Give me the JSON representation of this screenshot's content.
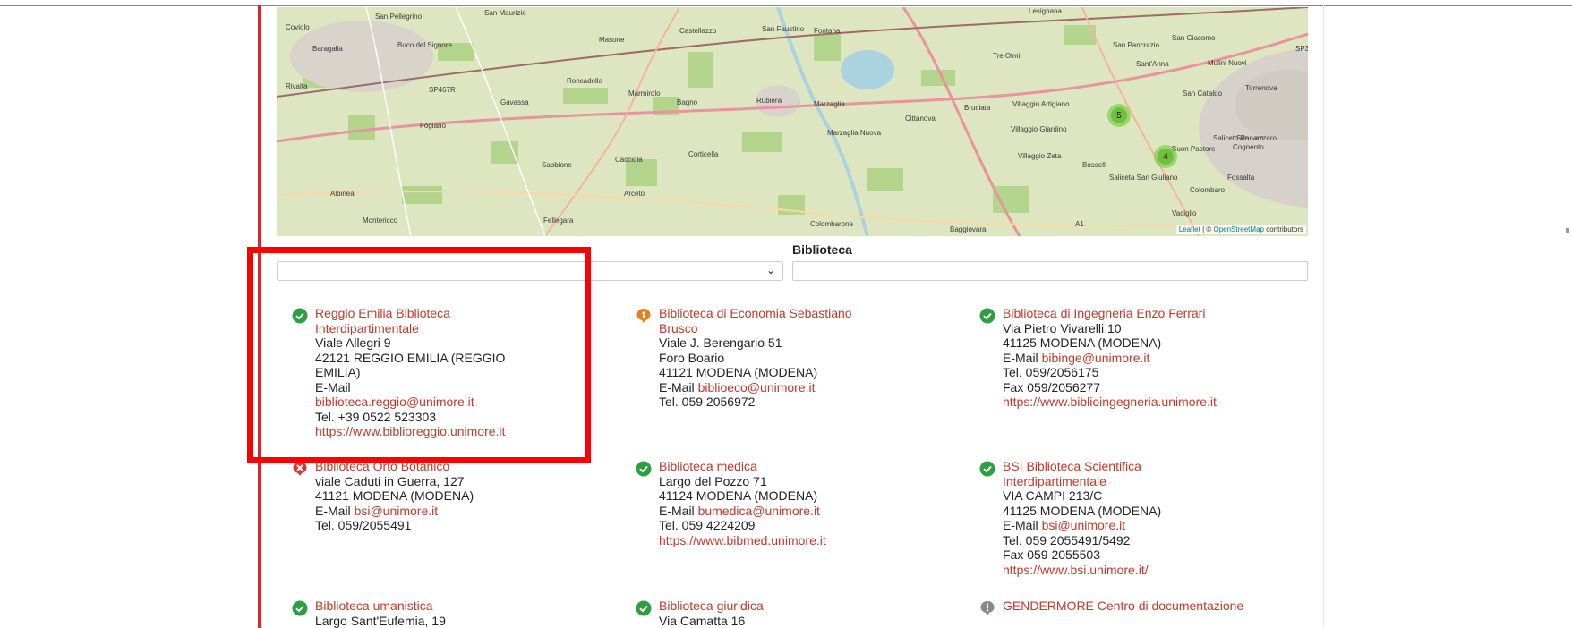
{
  "colors": {
    "accent": "#c0392b",
    "highlight": "#ff0000",
    "open": "#2e9e44",
    "partial": "#e67e22",
    "closed": "#e0322f",
    "unknown": "#888888"
  },
  "map": {
    "labels": [
      "Coviolo",
      "San Pellegrino",
      "San Maurizio",
      "Masone",
      "Castellazzo",
      "San Faustino",
      "Fontana",
      "Lesignana",
      "San Giacomo",
      "San Pancrazio",
      "Tre Olmi",
      "Sant'Anna",
      "Mulini Nuovi",
      "Baragalla",
      "Buco del Signore",
      "Rivalta",
      "SP467R",
      "Roncadella",
      "Marmirolo",
      "Gavassa",
      "Bagno",
      "Rubiera",
      "Marzaglia",
      "Cittanova",
      "Bruciata",
      "Villaggio Artigiano",
      "San Cataldo",
      "Torrenova",
      "Foglano",
      "Marzaglia Nuova",
      "Villaggio Giardino",
      "San Lazzaro",
      "Saliceto Panaro",
      "Cognento",
      "Buon Pastore",
      "Villaggio Zeta",
      "Bosselli",
      "Albinea",
      "Sabbione",
      "Cacciola",
      "Corticella",
      "Saliceta San Giuliano",
      "Colombaro",
      "Fossalta",
      "Montericco",
      "Arceto",
      "Fellegara",
      "Colombarone",
      "Baggiovara",
      "A1",
      "Vaciglio",
      "SP3"
    ],
    "clusters": [
      "5",
      "4"
    ],
    "attribution": {
      "leaflet": "Leaflet",
      "sep": " | © ",
      "osm": "OpenStreetMap",
      "rest": " contributors"
    }
  },
  "filters": {
    "biblioteca_label": "Biblioteca",
    "select_value": "",
    "input_value": ""
  },
  "libraries": [
    {
      "status": "open",
      "name": "Reggio Emilia Biblioteca Interdipartimentale",
      "lines": [
        "Viale Allegri 9",
        "42121 REGGIO EMILIA (REGGIO EMILIA)"
      ],
      "email_label": "E-Mail",
      "email": "biblioteca.reggio@unimore.it",
      "tel": "Tel. +39 0522 523303",
      "fax": "",
      "url": "https://www.biblioreggio.unimore.it"
    },
    {
      "status": "partial",
      "name": "Biblioteca di Economia Sebastiano Brusco",
      "lines": [
        "Viale J. Berengario 51",
        "Foro Boario",
        "41121 MODENA (MODENA)"
      ],
      "email_label": "E-Mail",
      "email": "biblioeco@unimore.it",
      "tel": "Tel. 059 2056972",
      "fax": "",
      "url": ""
    },
    {
      "status": "open",
      "name": "Biblioteca di Ingegneria Enzo Ferrari",
      "lines": [
        "Via Pietro Vivarelli 10",
        "41125 MODENA (MODENA)"
      ],
      "email_label": "E-Mail",
      "email": "bibinge@unimore.it",
      "tel": "Tel. 059/2056175",
      "fax": "Fax 059/2056277",
      "url": "https://www.biblioingegneria.unimore.it"
    },
    {
      "status": "closed",
      "name": "Biblioteca Orto Botanico",
      "lines": [
        "viale Caduti in Guerra, 127",
        "41121 MODENA (MODENA)"
      ],
      "email_label": "E-Mail",
      "email": "bsi@unimore.it",
      "tel": "Tel. 059/2055491",
      "fax": "",
      "url": ""
    },
    {
      "status": "open",
      "name": "Biblioteca medica",
      "lines": [
        "Largo del Pozzo 71",
        "41124 MODENA (MODENA)"
      ],
      "email_label": "E-Mail",
      "email": "bumedica@unimore.it",
      "tel": "Tel. 059 4224209",
      "fax": "",
      "url": "https://www.bibmed.unimore.it"
    },
    {
      "status": "open",
      "name": "BSI Biblioteca Scientifica Interdipartimentale",
      "lines": [
        "VIA CAMPI 213/C",
        "41125 MODENA (MODENA)"
      ],
      "email_label": "E-Mail",
      "email": "bsi@unimore.it",
      "tel": "Tel. 059 2055491/5492",
      "fax": "Fax 059 2055503",
      "url": "https://www.bsi.unimore.it/"
    },
    {
      "status": "open",
      "name": "Biblioteca umanistica",
      "lines": [
        "Largo Sant'Eufemia, 19"
      ],
      "email_label": "",
      "email": "",
      "tel": "",
      "fax": "",
      "url": ""
    },
    {
      "status": "open",
      "name": "Biblioteca giuridica",
      "lines": [
        "Via Camatta 16"
      ],
      "email_label": "",
      "email": "",
      "tel": "",
      "fax": "",
      "url": ""
    },
    {
      "status": "unknown",
      "name": "GENDERMORE Centro di documentazione",
      "lines": [],
      "email_label": "",
      "email": "",
      "tel": "",
      "fax": "",
      "url": ""
    }
  ]
}
